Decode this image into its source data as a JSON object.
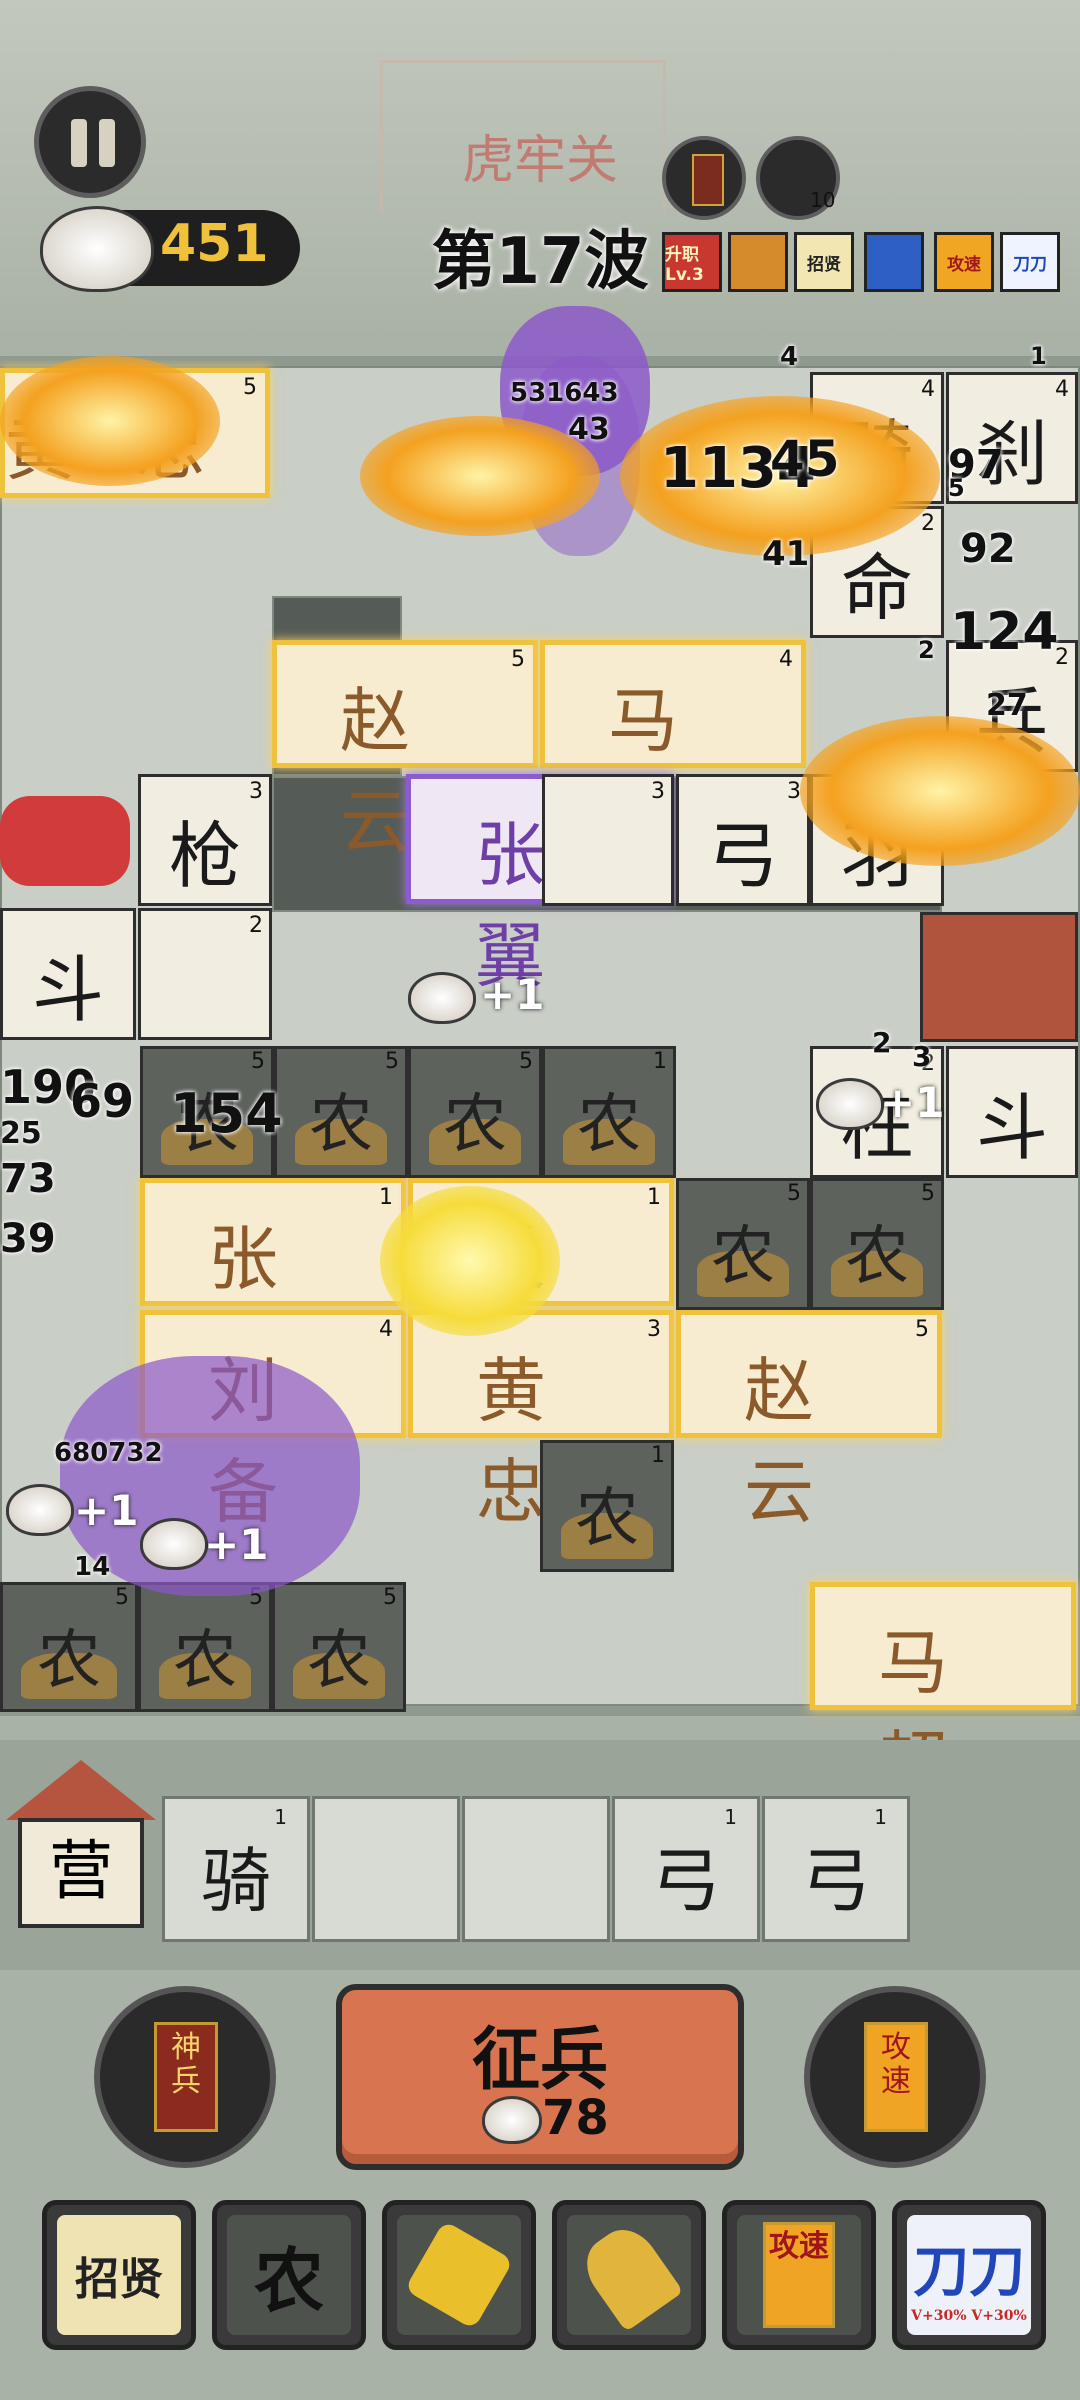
{
  "header": {
    "wall_title": "虎牢关",
    "coins": "451",
    "wave": "第17波",
    "round_badge": "10"
  },
  "buffs": [
    "升职 Lv.3",
    "",
    "招贤",
    "",
    "攻速",
    "刀刀"
  ],
  "board": {
    "heroes": [
      {
        "text": "黄忠",
        "level": "5"
      },
      {
        "text": "赵云",
        "level": "5"
      },
      {
        "text": "马超",
        "level": "4"
      },
      {
        "text": "张翼",
        "level": "3"
      },
      {
        "text": "张飞",
        "level": "1"
      },
      {
        "text": "关羽",
        "level": "1"
      },
      {
        "text": "刘备",
        "level": "4"
      },
      {
        "text": "黄忠",
        "level": "3"
      },
      {
        "text": "赵云",
        "level": "5"
      },
      {
        "text": "马超",
        "level": ""
      }
    ],
    "tiles": [
      {
        "text": "骑",
        "level": "4"
      },
      {
        "text": "刹",
        "level": "4"
      },
      {
        "text": "枪",
        "level": "3"
      },
      {
        "text": "弓",
        "level": "3"
      },
      {
        "text": "羽",
        "level": "1"
      },
      {
        "text": "斗",
        "level": ""
      },
      {
        "text": "",
        "level": "2"
      },
      {
        "text": "斗",
        "level": ""
      },
      {
        "text": "枉",
        "level": "2"
      },
      {
        "text": "命",
        "level": "2"
      },
      {
        "text": "兵",
        "level": "2"
      },
      {
        "text": "",
        "level": "3"
      }
    ],
    "farms": [
      {
        "text": "农",
        "level": "5"
      },
      {
        "text": "农",
        "level": "5"
      },
      {
        "text": "农",
        "level": "5"
      },
      {
        "text": "农",
        "level": "1"
      },
      {
        "text": "农",
        "level": "5"
      },
      {
        "text": "农",
        "level": "5"
      },
      {
        "text": "农",
        "level": "1"
      },
      {
        "text": "农",
        "level": "5"
      },
      {
        "text": "农",
        "level": "5"
      },
      {
        "text": "农",
        "level": "5"
      }
    ],
    "damage_numbers": [
      "531643",
      "43",
      "1134",
      "45",
      "41",
      "97",
      "5",
      "92",
      "124",
      "27",
      "4",
      "2",
      "1",
      "680732",
      "14",
      "154",
      "190",
      "69",
      "25",
      "73",
      "39",
      "2",
      "3"
    ],
    "plus_labels": [
      "+1",
      "+1",
      "+1",
      "+1"
    ]
  },
  "camp": {
    "label": "营",
    "slots": [
      {
        "text": "骑",
        "level": "1"
      },
      {
        "text": "",
        "level": ""
      },
      {
        "text": "",
        "level": ""
      },
      {
        "text": "弓",
        "level": "1"
      },
      {
        "text": "弓",
        "level": "1"
      }
    ]
  },
  "controls": {
    "left_card": "神兵",
    "recruit_label": "征兵",
    "recruit_cost": "78",
    "right_card": "攻速"
  },
  "tools": [
    "招贤",
    "农",
    "",
    "",
    "攻速",
    "刀刀"
  ],
  "tool_subtext": "V+30% V+30%"
}
